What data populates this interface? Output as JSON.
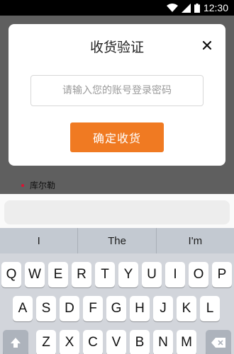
{
  "status_bar": {
    "time": "12:30"
  },
  "background": {
    "list_item_label": "库尔勒"
  },
  "modal": {
    "title": "收货验证",
    "close_icon": "close-icon",
    "password_placeholder": "请输入您的账号登录密码",
    "confirm_label": "确定收货",
    "accent_color": "#f07a22"
  },
  "keyboard": {
    "suggestions": [
      "I",
      "The",
      "I'm"
    ],
    "rows": [
      [
        "Q",
        "W",
        "E",
        "R",
        "T",
        "Y",
        "U",
        "I",
        "O",
        "P"
      ],
      [
        "A",
        "S",
        "D",
        "F",
        "G",
        "H",
        "J",
        "K",
        "L"
      ],
      [
        "Z",
        "X",
        "C",
        "V",
        "B",
        "N",
        "M"
      ]
    ],
    "shift_icon": "shift-icon",
    "backspace_icon": "backspace-icon"
  }
}
